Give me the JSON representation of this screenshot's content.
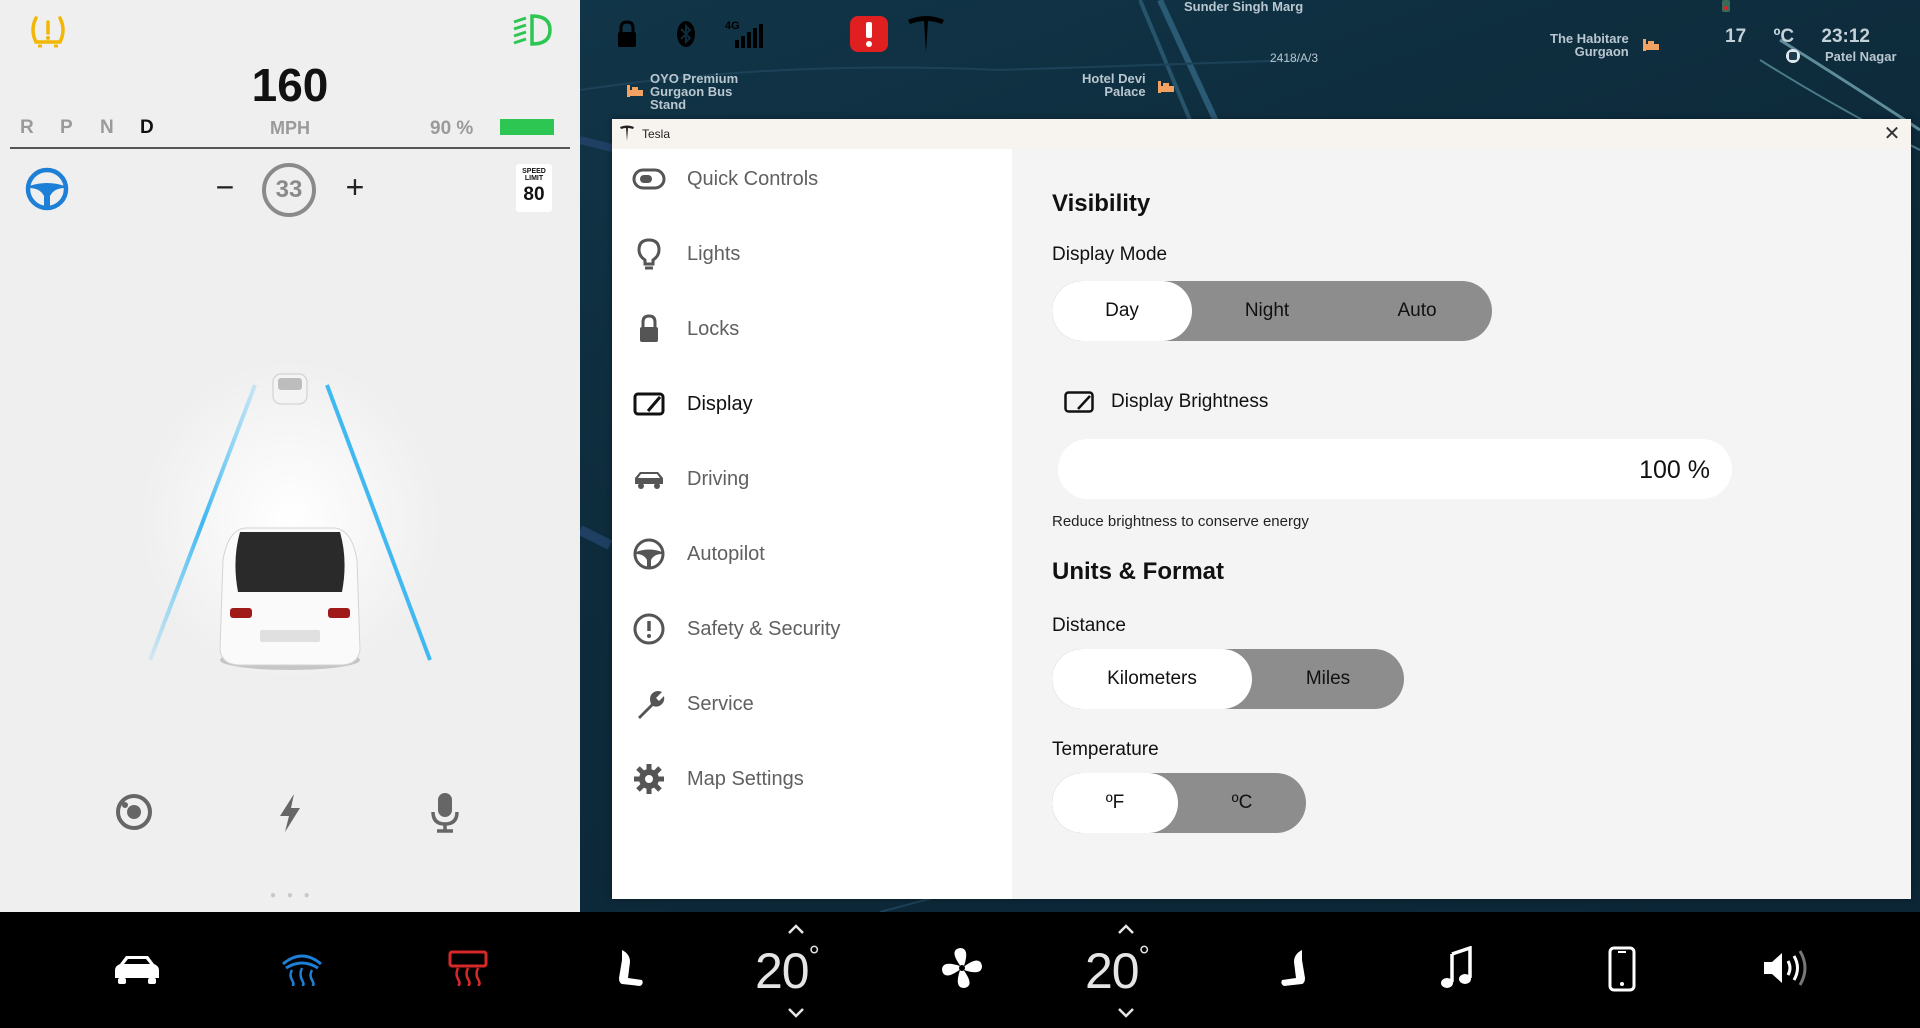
{
  "cluster": {
    "speed": "160",
    "gears": [
      "R",
      "P",
      "N",
      "D"
    ],
    "active_gear": "D",
    "speed_unit": "MPH",
    "battery_percent_text": "90 %",
    "battery_level": 0.9,
    "set_speed": "33",
    "minus_label": "−",
    "plus_label": "+",
    "speed_limit_caption_1": "SPEED",
    "speed_limit_caption_2": "LIMIT",
    "speed_limit_value": "80",
    "page_dots": "● ● ●",
    "icons": [
      "tpms-warning-icon",
      "headlight-icon",
      "steering-wheel-icon",
      "camera-icon",
      "lightning-icon",
      "microphone-icon"
    ],
    "colors": {
      "tpms": "#f2b705",
      "headlight": "#2dc653",
      "steering": "#1e7fd6",
      "battery": "#2dc653"
    }
  },
  "map": {
    "labels": {
      "street_top": "Sunder Singh Marg",
      "address": "2418/A/3",
      "oyo": "OYO Premium\nGurgaon Bus\nStand",
      "hotel": "Hotel Devi\nPalace",
      "habitare": "The Habitare\nGurgaon",
      "patel": "Patel Nagar"
    },
    "status": {
      "network": "4G",
      "temperature": "17 ºC",
      "time": "23:12"
    }
  },
  "window": {
    "title": "Tesla",
    "close_label": "✕",
    "nav": [
      {
        "label": "Quick Controls",
        "icon": "toggle-icon"
      },
      {
        "label": "Lights",
        "icon": "lightbulb-icon"
      },
      {
        "label": "Locks",
        "icon": "lock-icon"
      },
      {
        "label": "Display",
        "icon": "display-icon"
      },
      {
        "label": "Driving",
        "icon": "car-icon"
      },
      {
        "label": "Autopilot",
        "icon": "steering-wheel-icon"
      },
      {
        "label": "Safety & Security",
        "icon": "alert-icon"
      },
      {
        "label": "Service",
        "icon": "wrench-icon"
      },
      {
        "label": "Map Settings",
        "icon": "gear-icon"
      }
    ],
    "active_nav": "Display",
    "content": {
      "visibility_heading": "Visibility",
      "display_mode_label": "Display Mode",
      "display_mode_options": [
        "Day",
        "Night",
        "Auto"
      ],
      "display_mode_selected": "Day",
      "brightness_label": "Display Brightness",
      "brightness_value": "100 %",
      "brightness_note": "Reduce brightness to conserve energy",
      "units_heading": "Units & Format",
      "distance_label": "Distance",
      "distance_options": [
        "Kilometers",
        "Miles"
      ],
      "distance_selected": "Kilometers",
      "temperature_label": "Temperature",
      "temperature_options": [
        "ºF",
        "ºC"
      ],
      "temperature_selected": "ºF"
    }
  },
  "bottombar": {
    "left_temp": "20",
    "right_temp": "20",
    "degree": "°",
    "icons": [
      "car-icon",
      "front-defrost-icon",
      "rear-defrost-icon",
      "seat-heater-left-icon",
      "fan-icon",
      "seat-heater-right-icon",
      "music-icon",
      "phone-icon",
      "volume-icon"
    ],
    "colors": {
      "front_defrost": "#1e7fd6",
      "rear_defrost": "#d62828"
    }
  }
}
